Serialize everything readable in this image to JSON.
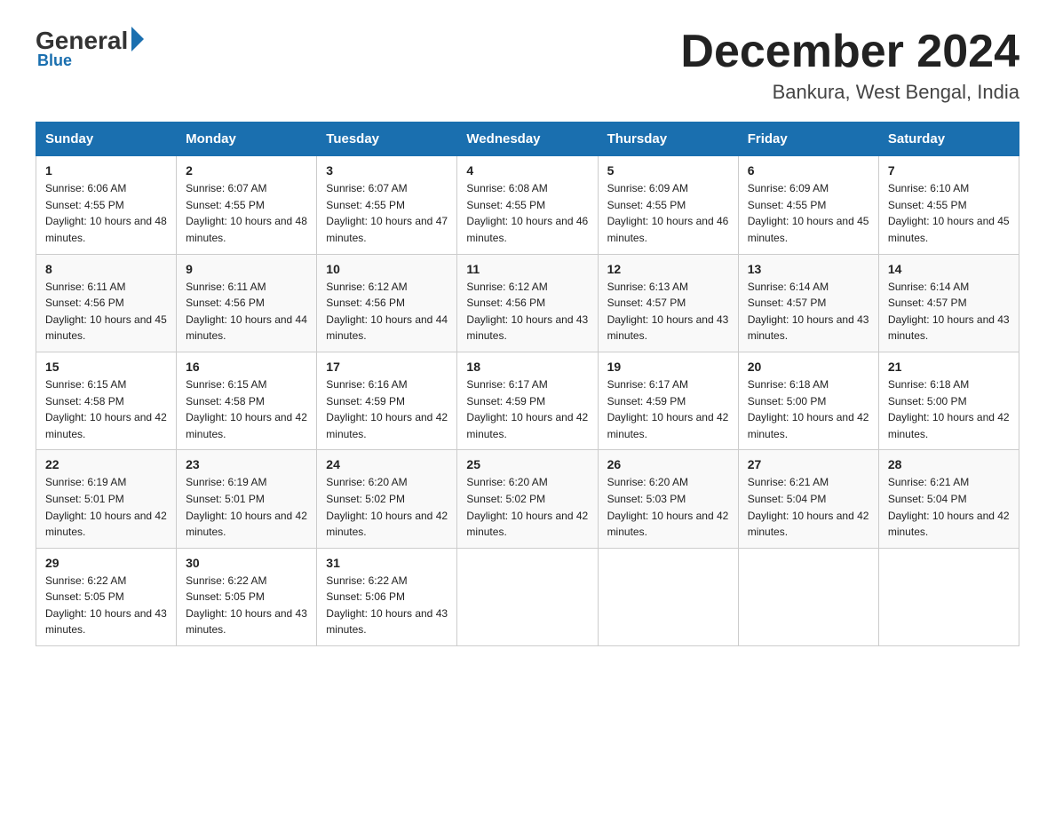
{
  "header": {
    "logo_general": "General",
    "logo_blue": "Blue",
    "month_title": "December 2024",
    "location": "Bankura, West Bengal, India"
  },
  "days_of_week": [
    "Sunday",
    "Monday",
    "Tuesday",
    "Wednesday",
    "Thursday",
    "Friday",
    "Saturday"
  ],
  "weeks": [
    [
      {
        "day": "1",
        "sunrise": "6:06 AM",
        "sunset": "4:55 PM",
        "daylight": "10 hours and 48 minutes."
      },
      {
        "day": "2",
        "sunrise": "6:07 AM",
        "sunset": "4:55 PM",
        "daylight": "10 hours and 48 minutes."
      },
      {
        "day": "3",
        "sunrise": "6:07 AM",
        "sunset": "4:55 PM",
        "daylight": "10 hours and 47 minutes."
      },
      {
        "day": "4",
        "sunrise": "6:08 AM",
        "sunset": "4:55 PM",
        "daylight": "10 hours and 46 minutes."
      },
      {
        "day": "5",
        "sunrise": "6:09 AM",
        "sunset": "4:55 PM",
        "daylight": "10 hours and 46 minutes."
      },
      {
        "day": "6",
        "sunrise": "6:09 AM",
        "sunset": "4:55 PM",
        "daylight": "10 hours and 45 minutes."
      },
      {
        "day": "7",
        "sunrise": "6:10 AM",
        "sunset": "4:55 PM",
        "daylight": "10 hours and 45 minutes."
      }
    ],
    [
      {
        "day": "8",
        "sunrise": "6:11 AM",
        "sunset": "4:56 PM",
        "daylight": "10 hours and 45 minutes."
      },
      {
        "day": "9",
        "sunrise": "6:11 AM",
        "sunset": "4:56 PM",
        "daylight": "10 hours and 44 minutes."
      },
      {
        "day": "10",
        "sunrise": "6:12 AM",
        "sunset": "4:56 PM",
        "daylight": "10 hours and 44 minutes."
      },
      {
        "day": "11",
        "sunrise": "6:12 AM",
        "sunset": "4:56 PM",
        "daylight": "10 hours and 43 minutes."
      },
      {
        "day": "12",
        "sunrise": "6:13 AM",
        "sunset": "4:57 PM",
        "daylight": "10 hours and 43 minutes."
      },
      {
        "day": "13",
        "sunrise": "6:14 AM",
        "sunset": "4:57 PM",
        "daylight": "10 hours and 43 minutes."
      },
      {
        "day": "14",
        "sunrise": "6:14 AM",
        "sunset": "4:57 PM",
        "daylight": "10 hours and 43 minutes."
      }
    ],
    [
      {
        "day": "15",
        "sunrise": "6:15 AM",
        "sunset": "4:58 PM",
        "daylight": "10 hours and 42 minutes."
      },
      {
        "day": "16",
        "sunrise": "6:15 AM",
        "sunset": "4:58 PM",
        "daylight": "10 hours and 42 minutes."
      },
      {
        "day": "17",
        "sunrise": "6:16 AM",
        "sunset": "4:59 PM",
        "daylight": "10 hours and 42 minutes."
      },
      {
        "day": "18",
        "sunrise": "6:17 AM",
        "sunset": "4:59 PM",
        "daylight": "10 hours and 42 minutes."
      },
      {
        "day": "19",
        "sunrise": "6:17 AM",
        "sunset": "4:59 PM",
        "daylight": "10 hours and 42 minutes."
      },
      {
        "day": "20",
        "sunrise": "6:18 AM",
        "sunset": "5:00 PM",
        "daylight": "10 hours and 42 minutes."
      },
      {
        "day": "21",
        "sunrise": "6:18 AM",
        "sunset": "5:00 PM",
        "daylight": "10 hours and 42 minutes."
      }
    ],
    [
      {
        "day": "22",
        "sunrise": "6:19 AM",
        "sunset": "5:01 PM",
        "daylight": "10 hours and 42 minutes."
      },
      {
        "day": "23",
        "sunrise": "6:19 AM",
        "sunset": "5:01 PM",
        "daylight": "10 hours and 42 minutes."
      },
      {
        "day": "24",
        "sunrise": "6:20 AM",
        "sunset": "5:02 PM",
        "daylight": "10 hours and 42 minutes."
      },
      {
        "day": "25",
        "sunrise": "6:20 AM",
        "sunset": "5:02 PM",
        "daylight": "10 hours and 42 minutes."
      },
      {
        "day": "26",
        "sunrise": "6:20 AM",
        "sunset": "5:03 PM",
        "daylight": "10 hours and 42 minutes."
      },
      {
        "day": "27",
        "sunrise": "6:21 AM",
        "sunset": "5:04 PM",
        "daylight": "10 hours and 42 minutes."
      },
      {
        "day": "28",
        "sunrise": "6:21 AM",
        "sunset": "5:04 PM",
        "daylight": "10 hours and 42 minutes."
      }
    ],
    [
      {
        "day": "29",
        "sunrise": "6:22 AM",
        "sunset": "5:05 PM",
        "daylight": "10 hours and 43 minutes."
      },
      {
        "day": "30",
        "sunrise": "6:22 AM",
        "sunset": "5:05 PM",
        "daylight": "10 hours and 43 minutes."
      },
      {
        "day": "31",
        "sunrise": "6:22 AM",
        "sunset": "5:06 PM",
        "daylight": "10 hours and 43 minutes."
      },
      null,
      null,
      null,
      null
    ]
  ]
}
